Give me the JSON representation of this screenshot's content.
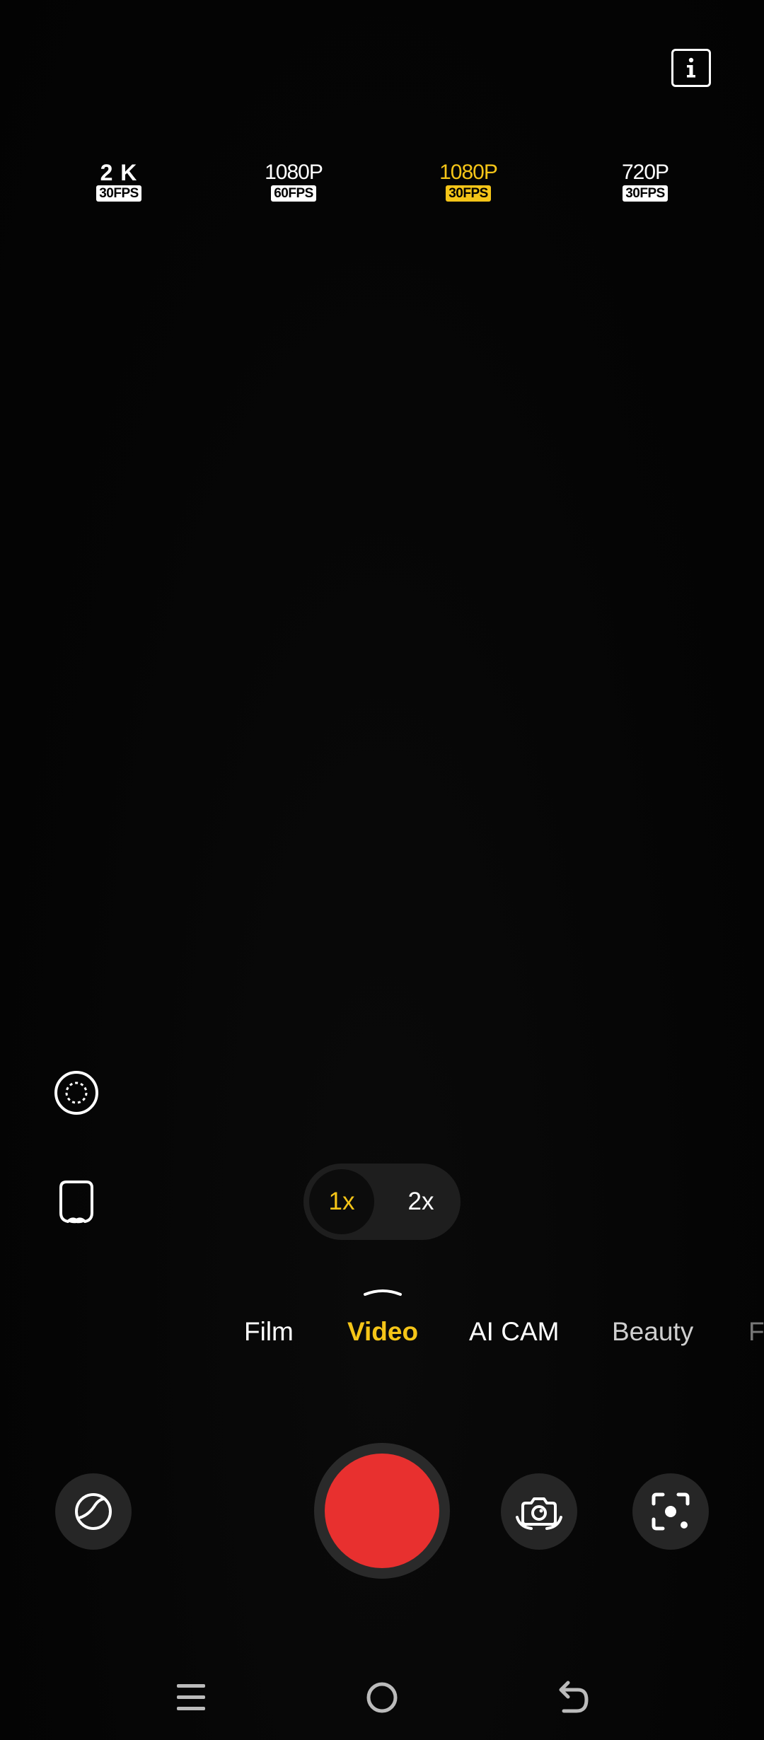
{
  "resolutions": [
    {
      "label": "2 K",
      "fps": "30FPS",
      "selected": false
    },
    {
      "label": "1080P",
      "fps": "60FPS",
      "selected": false
    },
    {
      "label": "1080P",
      "fps": "30FPS",
      "selected": true
    },
    {
      "label": "720P",
      "fps": "30FPS",
      "selected": false
    }
  ],
  "zoom": {
    "options": [
      "1x",
      "2x"
    ],
    "selected": "1x"
  },
  "modes": [
    "Film",
    "Video",
    "AI CAM",
    "Beauty",
    "F"
  ],
  "active_mode": "Video",
  "colors": {
    "accent": "#f5c518",
    "shutter": "#e8302f",
    "button_bg": "#262626",
    "background": "#040404"
  },
  "icons": {
    "top_right": "info-icon",
    "left_top": "motion-photo-icon",
    "left_bottom": "beauty-face-icon",
    "bottom_left": "filter-icon",
    "bottom_switch": "switch-camera-icon",
    "bottom_right": "focus-scan-icon",
    "nav": [
      "recent-apps-icon",
      "home-icon",
      "back-icon"
    ]
  }
}
